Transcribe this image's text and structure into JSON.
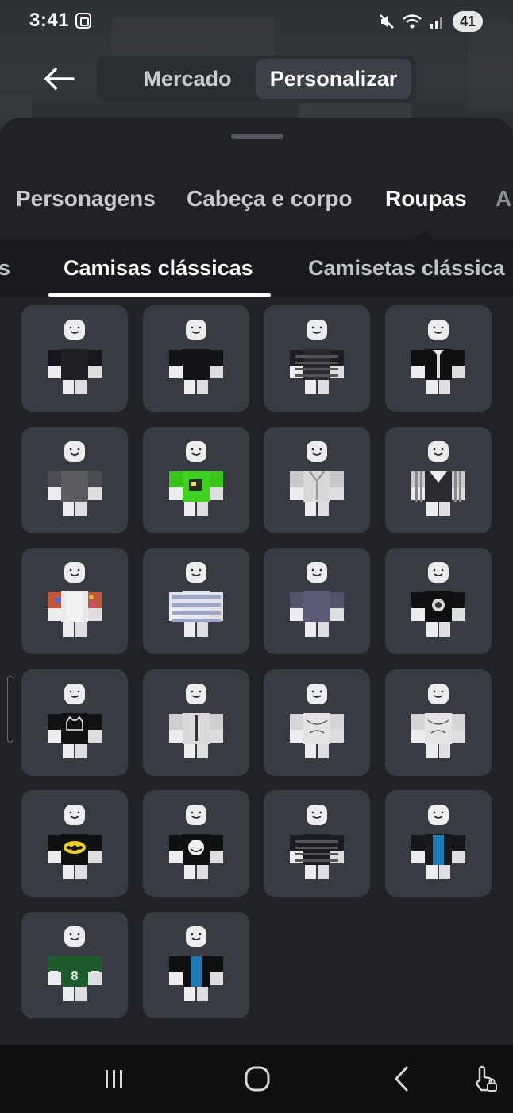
{
  "status_bar": {
    "time": "3:41",
    "battery": "41",
    "icons": [
      "screenshot-icon",
      "mute-icon",
      "wifi-icon",
      "signal-icon"
    ]
  },
  "header": {
    "back_icon": "arrow-left-icon",
    "tabs": [
      {
        "label": "Mercado",
        "active": false
      },
      {
        "label": "Personalizar",
        "active": true
      }
    ]
  },
  "category_tabs": [
    {
      "label": "Personagens",
      "active": false
    },
    {
      "label": "Cabeça e corpo",
      "active": false
    },
    {
      "label": "Roupas",
      "active": true
    },
    {
      "label": "A",
      "active": false
    }
  ],
  "subcategory_tabs": [
    {
      "label": "s",
      "active": false
    },
    {
      "label": "Camisas clássicas",
      "active": true
    },
    {
      "label": "Camisetas clássica",
      "active": false
    }
  ],
  "items": [
    {
      "shirt": "#1f2023",
      "sleeve": "#16171a",
      "pattern": "plain-dark"
    },
    {
      "shirt": "#121316",
      "sleeve": "#121316",
      "pattern": "plain"
    },
    {
      "shirt": "#2a2b2e",
      "sleeve": "#1d1e21",
      "pattern": "stripes-dark"
    },
    {
      "shirt": "#0f1012",
      "sleeve": "#0f1012",
      "pattern": "suit-tie"
    },
    {
      "shirt": "#5a5c60",
      "sleeve": "#4a4c50",
      "pattern": "plain"
    },
    {
      "shirt": "#3fd11f",
      "sleeve": "#39c41a",
      "pattern": "graphic"
    },
    {
      "shirt": "#d9d9db",
      "sleeve": "#c9c9cc",
      "pattern": "suit-light"
    },
    {
      "shirt": "#2a2b2f",
      "sleeve": "#c9c9cc",
      "pattern": "stripes-vertical"
    },
    {
      "shirt": "#e9e9ea",
      "sleeve": "#c0573a",
      "pattern": "floral"
    },
    {
      "shirt": "#e2e6ee",
      "sleeve": "#dfe3ea",
      "pattern": "stripes-blue"
    },
    {
      "shirt": "#5a5b74",
      "sleeve": "#52536a",
      "pattern": "plain"
    },
    {
      "shirt": "#0f1012",
      "sleeve": "#0f1012",
      "pattern": "print-face"
    },
    {
      "shirt": "#111214",
      "sleeve": "#111214",
      "pattern": "cat-print"
    },
    {
      "shirt": "#dadadc",
      "sleeve": "#cfcfd2",
      "pattern": "tie-light"
    },
    {
      "shirt": "#e4e4e6",
      "sleeve": "#d6d6d8",
      "pattern": "sketch"
    },
    {
      "shirt": "#e4e4e6",
      "sleeve": "#d6d6d8",
      "pattern": "sketch"
    },
    {
      "shirt": "#0f1012",
      "sleeve": "#0f1012",
      "pattern": "bat-logo"
    },
    {
      "shirt": "#0f1012",
      "sleeve": "#0f1012",
      "pattern": "troll-face"
    },
    {
      "shirt": "#1b1c1f",
      "sleeve": "#1b1c1f",
      "pattern": "stripes-dark"
    },
    {
      "shirt": "#1a1b1e",
      "sleeve": "#16171a",
      "pattern": "jacket-blue"
    },
    {
      "shirt": "#1d5a2c",
      "sleeve": "#1d5a2c",
      "pattern": "jersey-8"
    },
    {
      "shirt": "#0f1012",
      "sleeve": "#0f1012",
      "pattern": "jacket-blue"
    }
  ],
  "nav_bar": {
    "icons": [
      "recent-apps-icon",
      "home-icon",
      "back-nav-icon",
      "touch-lock-icon"
    ]
  }
}
